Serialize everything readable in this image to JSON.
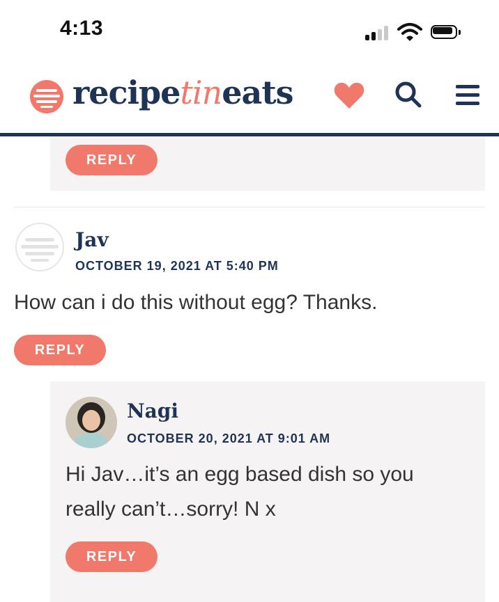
{
  "status_bar": {
    "time": "4:13",
    "icons": [
      "cellular-signal-icon",
      "wifi-icon",
      "battery-icon"
    ]
  },
  "header": {
    "logo_part1": "recipe",
    "logo_part2": "tin",
    "logo_part3": "eats",
    "accent_color": "#f0796b",
    "brand_color": "#1f3455",
    "icons": [
      "recipetineats-logo-icon",
      "heart-icon",
      "search-icon",
      "menu-icon"
    ]
  },
  "comments": {
    "reply_label": "REPLY",
    "items": [
      {
        "author": "Jav",
        "date": "OCTOBER 19, 2021 AT 5:40 PM",
        "text": "How can i do this without egg? Thanks.",
        "reply_label": "REPLY"
      }
    ],
    "replies": [
      {
        "author": "Nagi",
        "date": "OCTOBER 20, 2021 AT 9:01 AM",
        "text_line1": "Hi Jav…it’s an egg based dish so you",
        "text_line2": "really can’t…sorry! N x",
        "reply_label": "REPLY"
      }
    ]
  }
}
